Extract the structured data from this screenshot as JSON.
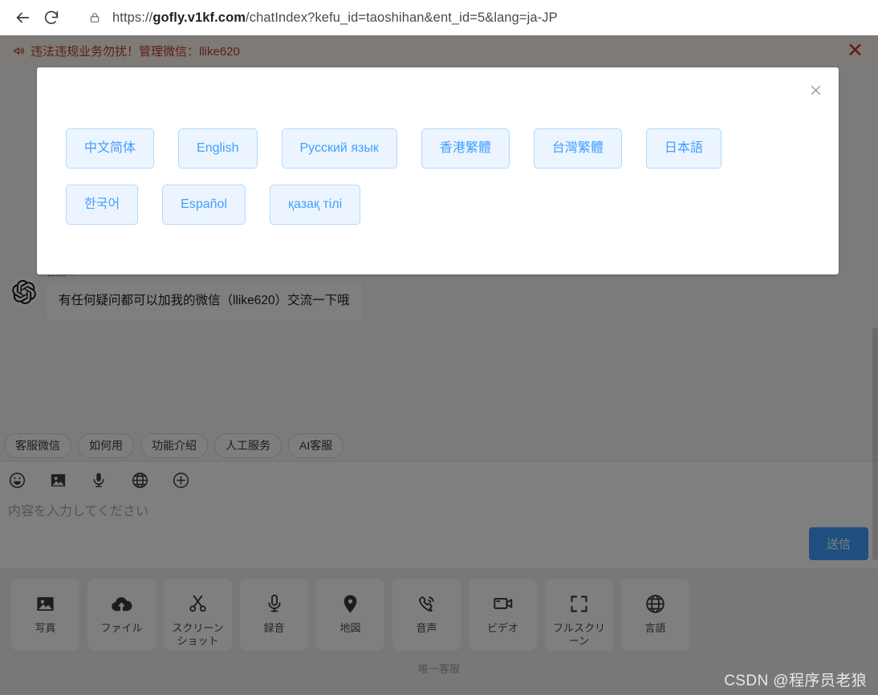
{
  "browser": {
    "back_label": "back-arrow",
    "reload_label": "reload",
    "lock_label": "site-information-lock",
    "url_prefix": "https://",
    "url_domain": "gofly.v1kf.com",
    "url_path": "/chatIndex?kefu_id=taoshihan&ent_id=5&lang=ja-JP",
    "url_full": "https://gofly.v1kf.com/chatIndex?kefu_id=taoshihan&ent_id=5&lang=ja-JP"
  },
  "announce": {
    "icon": "megaphone-icon",
    "text": "违法违规业务勿扰！管理微信：llike620",
    "close_label": "✕",
    "color": "#c0392b",
    "background": "#fdf6ec"
  },
  "modal": {
    "close_label": "✕",
    "languages": [
      {
        "label": "中文简体",
        "code": "zh-CN"
      },
      {
        "label": "English",
        "code": "en-US"
      },
      {
        "label": "Русский язык",
        "code": "ru-RU"
      },
      {
        "label": "香港繁體",
        "code": "zh-HK"
      },
      {
        "label": "台灣繁體",
        "code": "zh-TW"
      },
      {
        "label": "日本語",
        "code": "ja-JP"
      },
      {
        "label": "한국어",
        "code": "ko-KR"
      },
      {
        "label": "Español",
        "code": "es-ES"
      },
      {
        "label": "қазақ тілі",
        "code": "kk-KZ"
      }
    ],
    "accent": "#409eff",
    "button_bg": "#ecf5ff",
    "button_border": "#b3d8ff"
  },
  "chat": {
    "messages": [
      {
        "avatar": "openai-logo-avatar",
        "sender": "智能AI",
        "text": "有任何疑问都可以加我的微信（llike620）交流一下哦"
      }
    ],
    "quick_replies": [
      "客服微信",
      "如何用",
      "功能介绍",
      "人工服务",
      "AI客服"
    ]
  },
  "composer": {
    "tools": [
      {
        "name": "emoji-icon"
      },
      {
        "name": "image-icon"
      },
      {
        "name": "microphone-icon"
      },
      {
        "name": "globe-icon"
      },
      {
        "name": "plus-circle-icon"
      }
    ],
    "placeholder": "内容を入力してください",
    "send_label": "送信",
    "send_color": "#409eff"
  },
  "actions": {
    "items": [
      {
        "icon": "photo-icon",
        "label": "写真"
      },
      {
        "icon": "file-upload-icon",
        "label": "ファイル"
      },
      {
        "icon": "scissors-icon",
        "label": "スクリーンショット"
      },
      {
        "icon": "microphone-icon",
        "label": "録音"
      },
      {
        "icon": "map-pin-icon",
        "label": "地図"
      },
      {
        "icon": "phone-call-icon",
        "label": "音声"
      },
      {
        "icon": "video-camera-icon",
        "label": "ビデオ"
      },
      {
        "icon": "fullscreen-icon",
        "label": "フルスクリーン"
      },
      {
        "icon": "globe-icon",
        "label": "言語"
      }
    ],
    "footer": "唯一客服"
  },
  "watermark": "CSDN @程序员老狼"
}
